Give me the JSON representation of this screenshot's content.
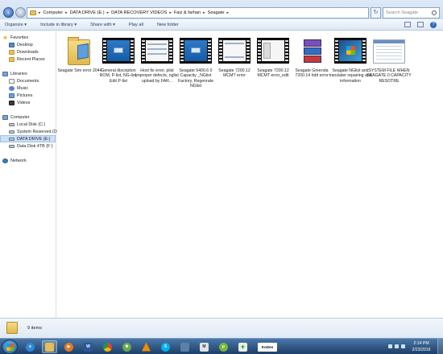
{
  "address": {
    "crumbs": [
      "Computer",
      "DATA DRIVE (E:)",
      "DATA RECOVERY VIDEOS",
      "Faiz & farhan",
      "Seagate"
    ],
    "search_placeholder": "Search Seagate"
  },
  "toolbar": {
    "organize": "Organize ▾",
    "include": "Include in library ▾",
    "share": "Share with ▾",
    "play_all": "Play all",
    "new_folder": "New folder"
  },
  "nav": {
    "favorites": "Favorites",
    "desktop": "Desktop",
    "downloads": "Downloads",
    "recent": "Recent Places",
    "libraries": "Libraries",
    "documents": "Documents",
    "music": "Music",
    "pictures": "Pictures",
    "videos": "Videos",
    "computer": "Computer",
    "local_disk": "Local Disk (C:)",
    "system_reserved": "System Reserved (D:",
    "data_drive": "DATA DRIVE (E:)",
    "data_disk": "Data Disk 4TB (F:)",
    "network": "Network"
  },
  "files": [
    {
      "name": "Seagate Sim error 2044",
      "type": "folder"
    },
    {
      "name": "General discription ROM, P-list, NG-list, Edit P-list",
      "type": "video"
    },
    {
      "name": "Host fix error, plist improper defects, nglist upload by FAR...",
      "type": "video"
    },
    {
      "name": "Seagate 5400.6 0 Capacity _NGlist Factory, Regenrate NGlist",
      "type": "video"
    },
    {
      "name": "Seagate 7200.12 MCMT error",
      "type": "video"
    },
    {
      "name": "Seagate 7200.12 MCMT error_edit",
      "type": "video"
    },
    {
      "name": "Seagate Greenda 7200.14 hdd error",
      "type": "archive"
    },
    {
      "name": "Seagate NGlist and translater repairing and information",
      "type": "video"
    },
    {
      "name": "SYSTEM FILE WHEN SEAGATE 0 CAPACITY RESOTRE",
      "type": "document"
    }
  ],
  "details": {
    "count": "9 items"
  },
  "taskbar": {
    "time": "2:14 PM",
    "date": "2/23/2016",
    "vlc_label": "KoDes"
  },
  "colors": {
    "accent": "#2f63b4",
    "taskbar": "#1d3f67",
    "folder": "#e1b84a"
  }
}
